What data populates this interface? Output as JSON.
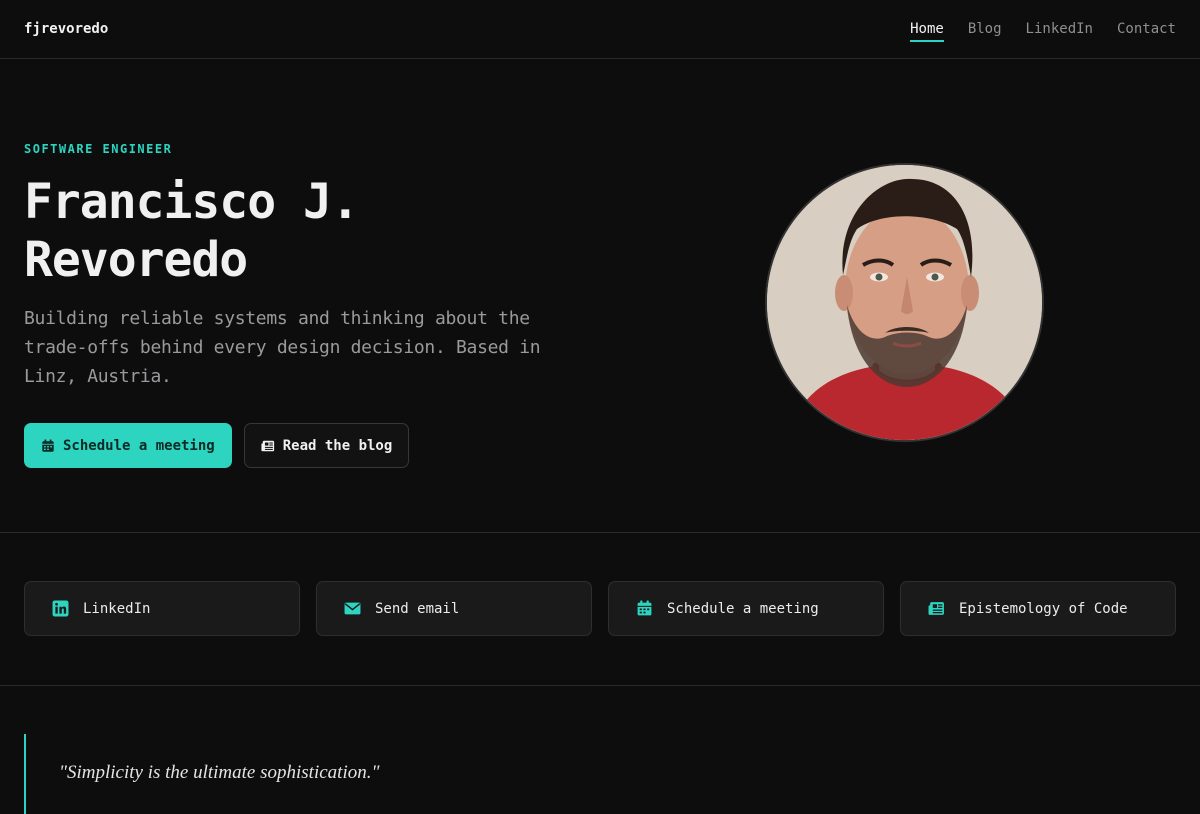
{
  "header": {
    "brand": "fjrevoredo",
    "nav": [
      {
        "label": "Home",
        "active": true
      },
      {
        "label": "Blog",
        "active": false
      },
      {
        "label": "LinkedIn",
        "active": false
      },
      {
        "label": "Contact",
        "active": false
      }
    ]
  },
  "hero": {
    "eyebrow": "SOFTWARE ENGINEER",
    "name": "Francisco J. Revoredo",
    "tagline": "Building reliable systems and thinking about the trade-offs behind every design decision. Based in Linz, Austria.",
    "primary_button": {
      "label": "Schedule a meeting",
      "icon": "calendar-icon"
    },
    "secondary_button": {
      "label": "Read the blog",
      "icon": "newspaper-icon"
    }
  },
  "links": [
    {
      "label": "LinkedIn",
      "icon": "linkedin-icon"
    },
    {
      "label": "Send email",
      "icon": "envelope-icon"
    },
    {
      "label": "Schedule a meeting",
      "icon": "calendar-icon"
    },
    {
      "label": "Epistemology of Code",
      "icon": "newspaper-icon"
    }
  ],
  "quote": {
    "text": "\"Simplicity is the ultimate sophistication.\""
  },
  "colors": {
    "accent": "#2dd4bf",
    "background": "#0d0d0e",
    "card": "#1a1a1b"
  }
}
